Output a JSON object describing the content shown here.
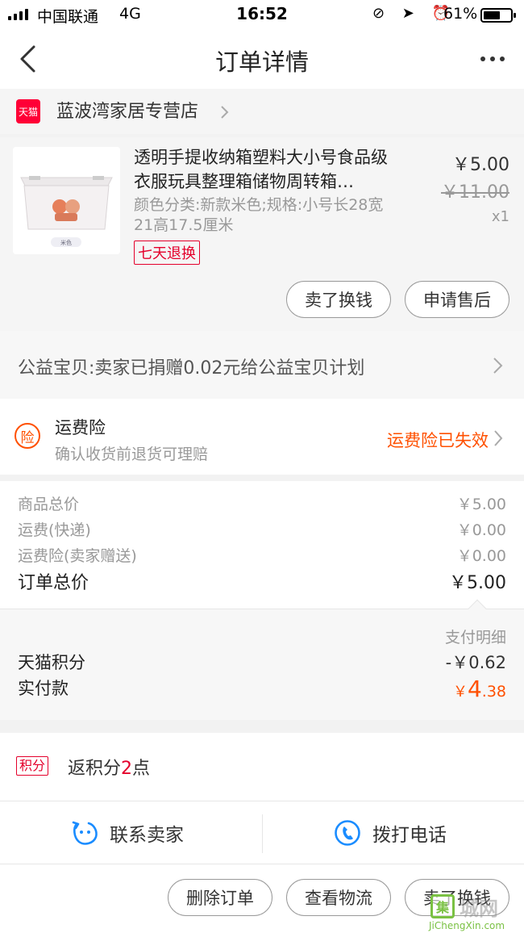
{
  "status_bar": {
    "carrier": "中国联通",
    "network": "4G",
    "time": "16:52",
    "status_icons": "⊘ ➤ ⏰",
    "battery_pct": "61%",
    "battery_level": 0.61
  },
  "nav": {
    "title": "订单详情"
  },
  "shop": {
    "badge": "天猫",
    "name": "蓝波湾家居专营店"
  },
  "product": {
    "title": "透明手提收纳箱塑料大小号食品级衣服玩具整理箱储物周转箱…",
    "sku": "颜色分类:新款米色;规格:小号长28宽21高17.5厘米",
    "tag": "七天退换",
    "price": "￥5.00",
    "original_price": "￥11.00",
    "quantity": "x1",
    "thumb_label": "米色",
    "buttons": {
      "sell": "卖了换钱",
      "after_sale": "申请售后"
    }
  },
  "charity": {
    "text": "公益宝贝:卖家已捐赠0.02元给公益宝贝计划"
  },
  "insurance": {
    "icon_char": "险",
    "title": "运费险",
    "subtitle": "确认收货前退货可理赔",
    "status": "运费险已失效"
  },
  "totals": {
    "goods_label": "商品总价",
    "goods_value": "￥5.00",
    "shipping_label": "运费(快递)",
    "shipping_value": "￥0.00",
    "ins_label": "运费险(卖家赠送)",
    "ins_value": "￥0.00",
    "order_label": "订单总价",
    "order_value": "￥5.00"
  },
  "payment": {
    "detail_label": "支付明细",
    "points_label": "天猫积分",
    "points_value": "-￥0.62",
    "paid_label": "实付款",
    "paid_currency": "￥",
    "paid_int": "4",
    "paid_dec": ".38"
  },
  "points": {
    "badge": "积分",
    "text_prefix": "返积分",
    "num": "2",
    "text_suffix": "点"
  },
  "contact": {
    "seller": "联系卖家",
    "phone": "拨打电话"
  },
  "actions": {
    "delete": "删除订单",
    "logistics": "查看物流",
    "sell": "卖了换钱"
  },
  "watermark": {
    "box": "集",
    "cn": "城网",
    "en": "JiChengXin.com"
  },
  "colors": {
    "accent": "#ff5000",
    "tmall_red": "#e4002b",
    "bg": "#f2f2f2"
  }
}
